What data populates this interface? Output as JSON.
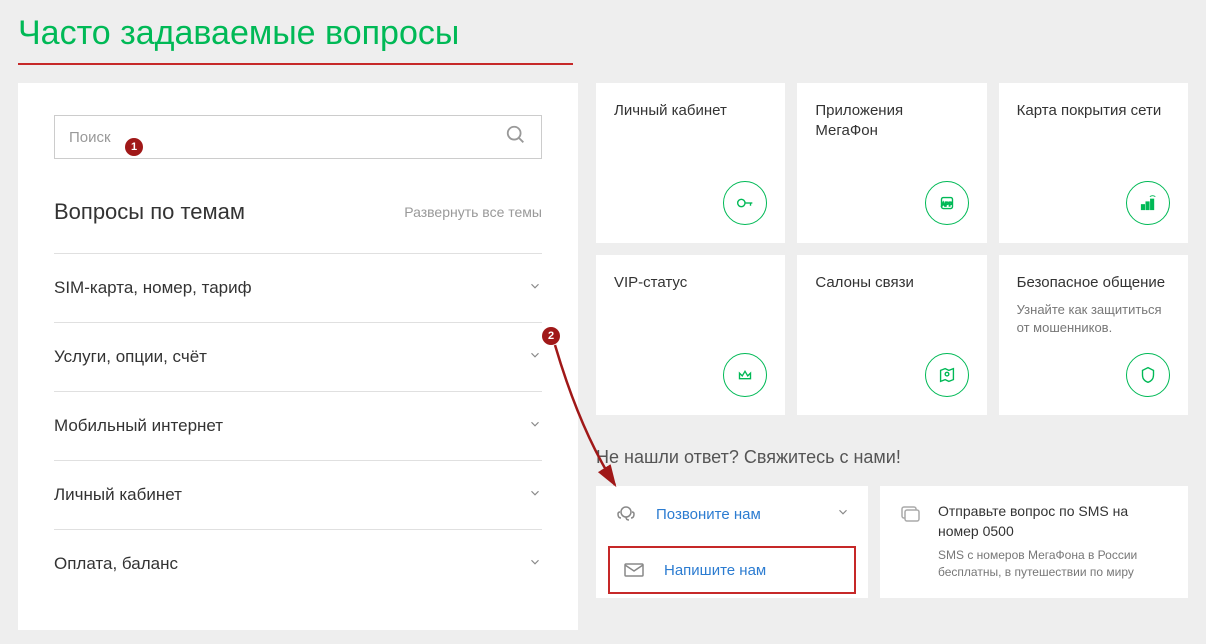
{
  "page": {
    "title": "Часто задаваемые вопросы"
  },
  "search": {
    "placeholder": "Поиск"
  },
  "topics": {
    "heading": "Вопросы по темам",
    "expand_all": "Развернуть все темы",
    "items": [
      {
        "label": "SIM-карта, номер, тариф"
      },
      {
        "label": "Услуги, опции, счёт"
      },
      {
        "label": "Мобильный интернет"
      },
      {
        "label": "Личный кабинет"
      },
      {
        "label": "Оплата, баланс"
      }
    ]
  },
  "cards": {
    "row1": [
      {
        "title": "Личный кабинет",
        "subtitle": ""
      },
      {
        "title": "Приложения МегаФон",
        "subtitle": ""
      },
      {
        "title": "Карта покрытия сети",
        "subtitle": ""
      }
    ],
    "row2": [
      {
        "title": "VIP-статус",
        "subtitle": ""
      },
      {
        "title": "Салоны связи",
        "subtitle": ""
      },
      {
        "title": "Безопасное общение",
        "subtitle": "Узнайте как защититься от мошенников."
      }
    ]
  },
  "contact": {
    "heading": "Не нашли ответ? Свяжитесь с нами!",
    "call": "Позвоните нам",
    "write": "Напишите нам",
    "sms_title": "Отправьте вопрос по SMS на номер 0500",
    "sms_desc": "SMS с номеров МегаФона в России бесплатны, в путешествии по миру"
  },
  "annotations": {
    "badge1": "1",
    "badge2": "2"
  }
}
